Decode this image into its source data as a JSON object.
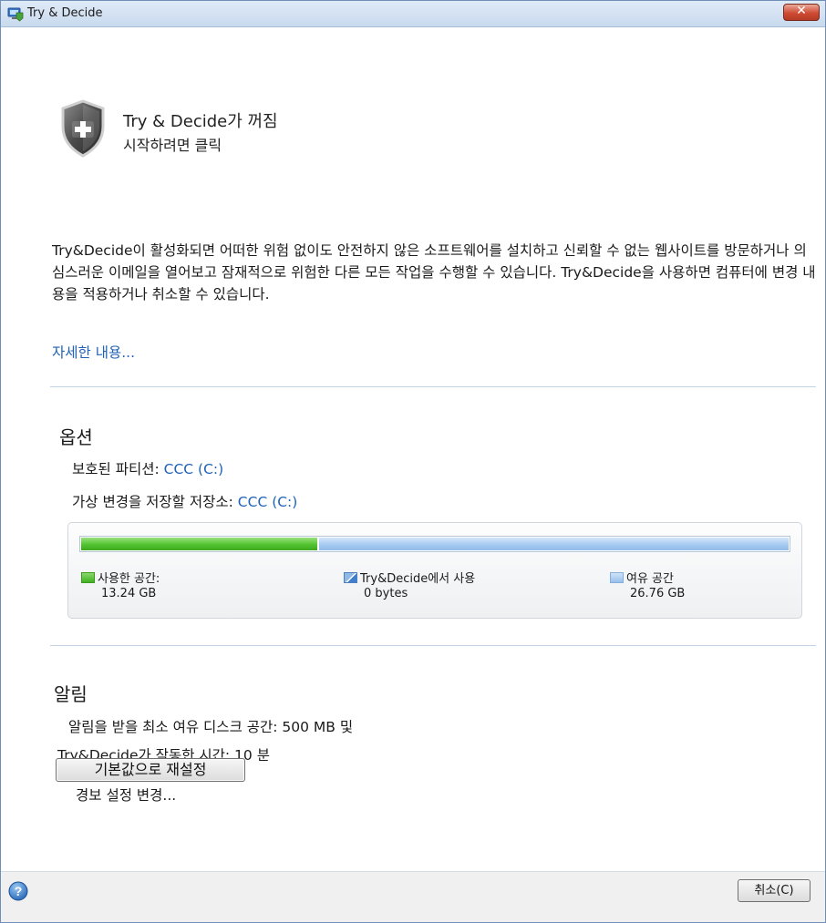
{
  "window": {
    "title": "Try & Decide",
    "close_glyph": "✕"
  },
  "status": {
    "title": "Try & Decide가 꺼짐",
    "subtitle": "시작하려면 클릭",
    "icon": "shield-plus-icon"
  },
  "description": "Try&Decide이 활성화되면 어떠한 위험 없이도 안전하지 않은 소프트웨어를 설치하고 신뢰할 수 없는 웹사이트를 방문하거나 의심스러운 이메일을 열어보고 잠재적으로 위험한 다른 모든 작업을 수행할 수 있습니다. Try&Decide을 사용하면 컴퓨터에 변경 내용을 적용하거나 취소할 수 있습니다.",
  "more_link": "자세한 내용...",
  "options": {
    "title": "옵션",
    "protected_label": "보호된 파티션: ",
    "protected_value": "CCC (C:)",
    "storage_label": "가상 변경을 저장할 저장소: ",
    "storage_value": "CCC (C:)"
  },
  "disk": {
    "used_fraction": 0.3335,
    "trydecide_fraction": 0.0,
    "colors": {
      "used": "#52c42f",
      "free": "#a7cbf1"
    },
    "legend": {
      "used": {
        "label": "사용한 공간:",
        "value": "13.24 GB"
      },
      "trydecide": {
        "label": "Try&Decide에서 사용",
        "value": "0 bytes"
      },
      "free": {
        "label": "여유 공간",
        "value": "26.76 GB"
      }
    }
  },
  "alerts": {
    "title": "알림",
    "line1": "알림을 받을 최소 여유 디스크 공간: 500 MB 및",
    "line2": "Try&Decide가 작동한 시간: 10 분",
    "change_link": "경보 설정 변경..."
  },
  "reset_button": "기본값으로 재설정",
  "footer": {
    "cancel_button": "취소(C)",
    "help_icon": "help-icon"
  }
}
